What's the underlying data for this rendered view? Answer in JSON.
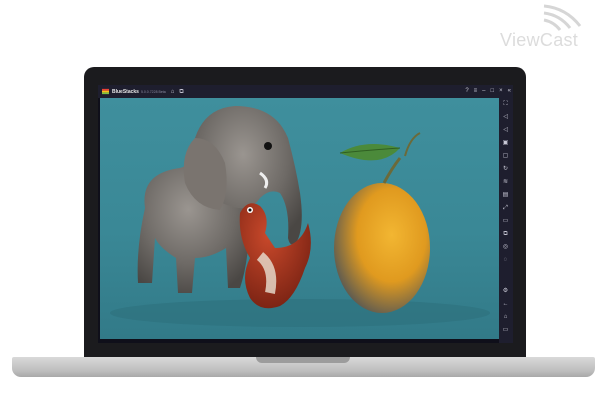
{
  "watermark": {
    "text": "ViewCast"
  },
  "window": {
    "app_name": "BlueStacks",
    "version": "5.0.0.7228  Beta",
    "home_icon": "home-icon",
    "multi_instance_icon": "multi-instance-icon",
    "title_controls": [
      "help-icon",
      "menu-icon",
      "minimize-icon",
      "restore-icon",
      "close-icon",
      "collapse-sidebar-icon"
    ]
  },
  "sidebar": {
    "tools": [
      "fullscreen-icon",
      "volume-up-icon",
      "volume-down-icon",
      "media-icon",
      "screenshot-icon",
      "rotate-icon",
      "shake-icon",
      "macro-icon",
      "scale-icon",
      "folder-icon",
      "multi-instance-manager-icon",
      "eco-mode-icon",
      "sync-icon"
    ],
    "bottom_tools": [
      "settings-icon",
      "back-icon",
      "home-icon",
      "recent-apps-icon"
    ]
  },
  "scene": {
    "background_color": "#3a8896",
    "elements": [
      "elephant",
      "bird",
      "lemon"
    ]
  }
}
